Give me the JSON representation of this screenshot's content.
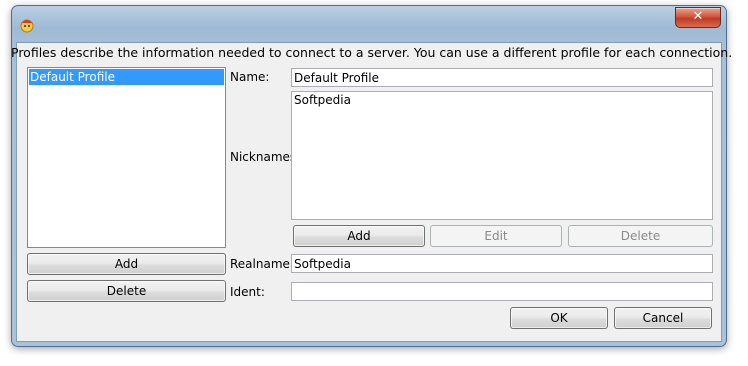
{
  "titlebar": {
    "close_label": "✕"
  },
  "description": "Profiles describe the information needed to connect to a server. You can use a different profile for each connection.",
  "profiles": {
    "items": [
      "Default Profile"
    ],
    "add_label": "Add",
    "delete_label": "Delete"
  },
  "form": {
    "name_label": "Name:",
    "name_value": "Default Profile",
    "nicknames_label": "Nicknames:",
    "nicknames_value": "Softpedia",
    "nick_add_label": "Add",
    "nick_edit_label": "Edit",
    "nick_delete_label": "Delete",
    "realname_label": "Realname:",
    "realname_value": "Softpedia",
    "ident_label": "Ident:",
    "ident_value": ""
  },
  "dialog": {
    "ok_label": "OK",
    "cancel_label": "Cancel"
  }
}
